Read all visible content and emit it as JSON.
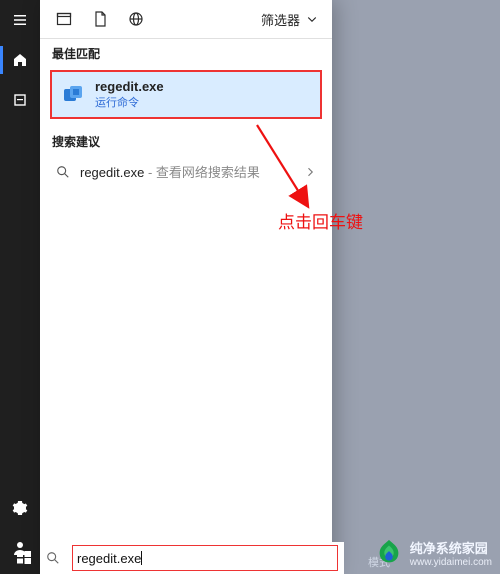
{
  "sidebar": {
    "top": [
      {
        "name": "sidebar-menu",
        "svg": "<rect x='2' y='3' width='12' height='1.5'/><rect x='2' y='7.25' width='12' height='1.5'/><rect x='2' y='11.5' width='12' height='1.5'/>"
      },
      {
        "name": "sidebar-home",
        "svg": "<path d='M8 2 L14 7 L14 14 L10 14 L10 10 L6 10 L6 14 L2 14 L2 7 Z'/>",
        "active": true
      },
      {
        "name": "sidebar-history",
        "svg": "<rect x='3' y='3' width='10' height='10' fill='none' stroke='#fff' stroke-width='1.4'/><rect x='5' y='7' width='6' height='1.2'/>"
      }
    ],
    "bottom": [
      {
        "name": "sidebar-settings",
        "svg": "<path d='M8 5a3 3 0 1 0 0 6 3 3 0 0 0 0-6zm6 3c0-.4 0-.8-.1-1.1l1.4-1.1-1.4-2.3-1.7.6a6 6 0 0 0-1.9-1.1L10 1H6l-.3 1.9a6 6 0 0 0-1.9 1.1l-1.7-.6L.7 5.7l1.4 1.1C2 7.2 2 7.6 2 8s0 .8.1 1.1L.7 10.3l1.4 2.3 1.7-.6a6 6 0 0 0 1.9 1.1L6 15h4l.3-1.9a6 6 0 0 0 1.9-1.1l1.7.6 1.4-2.3-1.4-1.1c.1-.4.1-.8.1-1.2z'/>"
      },
      {
        "name": "sidebar-user",
        "svg": "<circle cx='8' cy='5' r='3'/><path d='M2 15c0-3 3-5 6-5s6 2 6 5z'/>"
      }
    ]
  },
  "panel": {
    "filters_label": "筛选器",
    "section_best": "最佳匹配",
    "result": {
      "title": "regedit.exe",
      "subtitle": "运行命令"
    },
    "section_suggest": "搜索建议",
    "suggestion": {
      "query": "regedit.exe",
      "hint": " - 查看网络搜索结果"
    }
  },
  "search": {
    "value": "regedit.exe"
  },
  "annotation": "点击回车键",
  "tray_label": "模式",
  "watermark": {
    "title": "纯净系统家园",
    "url": "www.yidaimei.com"
  }
}
